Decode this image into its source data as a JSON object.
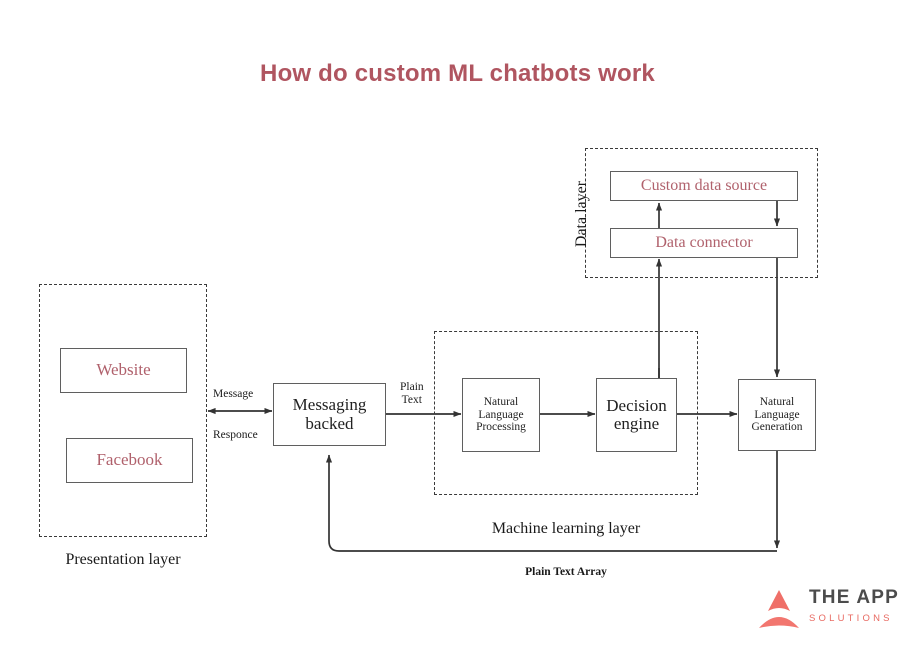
{
  "title": "How do custom ML chatbots work",
  "colors": {
    "title": "#b05560",
    "rose_text": "#b0616c",
    "box_border": "#5f5f5f",
    "dashed_border": "#3a3a3a",
    "line": "#333333",
    "logo_coral": "#e86a62",
    "logo_gray": "#4c4c4c"
  },
  "groups": {
    "presentation": {
      "label": "Presentation layer"
    },
    "machine_learning": {
      "label": "Machine learning layer"
    },
    "data": {
      "label": "Data layer"
    }
  },
  "nodes": {
    "website": {
      "label": "Website"
    },
    "facebook": {
      "label": "Facebook"
    },
    "messaging_backend": {
      "line1": "Messaging",
      "line2": "backed"
    },
    "nlp": {
      "line1": "Natural",
      "line2": "Language",
      "line3": "Processing"
    },
    "decision_engine": {
      "line1": "Decision",
      "line2": "engine"
    },
    "nlg": {
      "line1": "Natural",
      "line2": "Language",
      "line3": "Generation"
    },
    "custom_data_source": {
      "label": "Custom data source"
    },
    "data_connector": {
      "label": "Data connector"
    }
  },
  "edge_labels": {
    "message": "Message",
    "responce": "Responce",
    "plain_text_line1": "Plain",
    "plain_text_line2": "Text",
    "plain_text_array": "Plain Text Array"
  },
  "logo": {
    "mark": "triangle-mark-icon",
    "primary": "THE APP",
    "secondary": "SOLUTIONS"
  }
}
